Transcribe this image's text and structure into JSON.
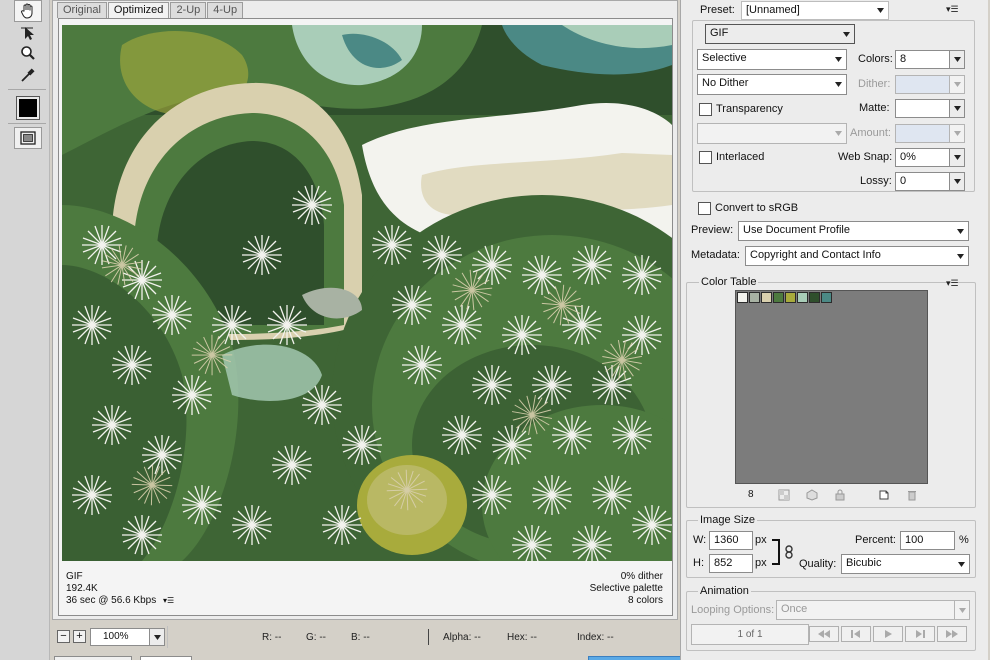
{
  "tools": [
    {
      "name": "hand-tool",
      "icon": "hand-icon",
      "active": true
    },
    {
      "name": "slice-select-tool",
      "icon": "slice-select-icon"
    },
    {
      "name": "zoom-tool",
      "icon": "zoom-icon"
    },
    {
      "name": "eyedropper-tool",
      "icon": "eyedropper-icon"
    },
    {
      "name": "eyedropper-color",
      "icon": "color-swatch",
      "color": "#000000"
    },
    {
      "name": "toggle-slices-visibility",
      "icon": "slices-visibility-icon"
    }
  ],
  "tabs": [
    {
      "label": "Original",
      "selected": false
    },
    {
      "label": "Optimized",
      "selected": true
    },
    {
      "label": "2-Up",
      "selected": false
    },
    {
      "label": "4-Up",
      "selected": false
    }
  ],
  "preview": {
    "info_left": [
      "GIF",
      "192.4K",
      "36 sec @ 56.6 Kbps"
    ],
    "info_right": [
      "0% dither",
      "Selective palette",
      "8 colors"
    ],
    "download_menu_icon": "menu-icon"
  },
  "statusbar": {
    "zoom_out": "−",
    "zoom_in": "+",
    "zoom": "100%",
    "r": "R: --",
    "g": "G: --",
    "b": "B: --",
    "alpha": "Alpha: --",
    "hex": "Hex: --",
    "index": "Index: --"
  },
  "settings": {
    "preset_label": "Preset:",
    "preset_value": "[Unnamed]",
    "format": "GIF",
    "reduction": "Selective",
    "dither_algorithm": "No Dither",
    "colors_label": "Colors:",
    "colors_value": "8",
    "dither_label": "Dither:",
    "dither_value": "",
    "transparency_label": "Transparency",
    "transparency_checked": false,
    "matte_label": "Matte:",
    "matte_value": "",
    "transparency_dither": "",
    "amount_label": "Amount:",
    "amount_value": "",
    "interlaced_label": "Interlaced",
    "interlaced_checked": false,
    "websnap_label": "Web Snap:",
    "websnap_value": "0%",
    "lossy_label": "Lossy:",
    "lossy_value": "0",
    "convert_srgb_label": "Convert to sRGB",
    "convert_srgb_checked": false,
    "preview_label": "Preview:",
    "preview_value": "Use Document Profile",
    "metadata_label": "Metadata:",
    "metadata_value": "Copyright and Contact Info"
  },
  "color_table": {
    "title": "Color Table",
    "count": "8",
    "swatches": [
      "#f3f3ee",
      "#a8b2a3",
      "#d9d0ae",
      "#4d7a3f",
      "#a8ab3c",
      "#a9cdb8",
      "#2f4f2c",
      "#4b8985"
    ],
    "tool_icons": [
      "map-to-transparent-icon",
      "web-snap-icon",
      "lock-color-icon",
      "new-color-icon",
      "delete-color-icon"
    ]
  },
  "image_size": {
    "title": "Image Size",
    "w_label": "W:",
    "w_value": "1360",
    "h_label": "H:",
    "h_value": "852",
    "unit": "px",
    "percent_label": "Percent:",
    "percent_value": "100",
    "percent_unit": "%",
    "quality_label": "Quality:",
    "quality_value": "Bicubic"
  },
  "animation": {
    "title": "Animation",
    "looping_label": "Looping Options:",
    "looping_value": "Once",
    "frame_counter": "1 of 1"
  }
}
